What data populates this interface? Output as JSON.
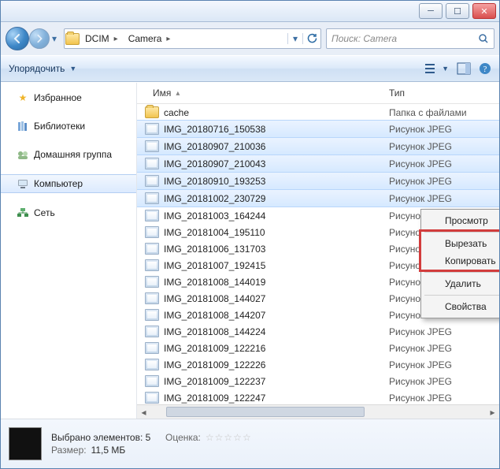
{
  "window": {
    "min": "─",
    "max": "☐",
    "close": "✕"
  },
  "breadcrumbs": [
    "DCIM",
    "Camera"
  ],
  "search": {
    "placeholder": "Поиск: Camera"
  },
  "toolbar": {
    "organize": "Упорядочить"
  },
  "nav": {
    "favorites": "Избранное",
    "libraries": "Библиотеки",
    "homegroup": "Домашняя группа",
    "computer": "Компьютер",
    "network": "Сеть"
  },
  "columns": {
    "name": "Имя",
    "type": "Тип"
  },
  "types": {
    "folder": "Папка с файлами",
    "jpeg": "Рисунок JPEG"
  },
  "files": [
    {
      "name": "cache",
      "kind": "folder",
      "sel": false
    },
    {
      "name": "IMG_20180716_150538",
      "kind": "jpeg",
      "sel": true
    },
    {
      "name": "IMG_20180907_210036",
      "kind": "jpeg",
      "sel": true
    },
    {
      "name": "IMG_20180907_210043",
      "kind": "jpeg",
      "sel": true
    },
    {
      "name": "IMG_20180910_193253",
      "kind": "jpeg",
      "sel": true
    },
    {
      "name": "IMG_20181002_230729",
      "kind": "jpeg",
      "sel": true
    },
    {
      "name": "IMG_20181003_164244",
      "kind": "jpeg",
      "sel": false
    },
    {
      "name": "IMG_20181004_195110",
      "kind": "jpeg",
      "sel": false
    },
    {
      "name": "IMG_20181006_131703",
      "kind": "jpeg",
      "sel": false
    },
    {
      "name": "IMG_20181007_192415",
      "kind": "jpeg",
      "sel": false
    },
    {
      "name": "IMG_20181008_144019",
      "kind": "jpeg",
      "sel": false
    },
    {
      "name": "IMG_20181008_144027",
      "kind": "jpeg",
      "sel": false
    },
    {
      "name": "IMG_20181008_144207",
      "kind": "jpeg",
      "sel": false
    },
    {
      "name": "IMG_20181008_144224",
      "kind": "jpeg",
      "sel": false
    },
    {
      "name": "IMG_20181009_122216",
      "kind": "jpeg",
      "sel": false
    },
    {
      "name": "IMG_20181009_122226",
      "kind": "jpeg",
      "sel": false
    },
    {
      "name": "IMG_20181009_122237",
      "kind": "jpeg",
      "sel": false
    },
    {
      "name": "IMG_20181009_122247",
      "kind": "jpeg",
      "sel": false
    }
  ],
  "ctx": {
    "view": "Просмотр",
    "cut": "Вырезать",
    "copy": "Копировать",
    "delete": "Удалить",
    "props": "Свойства"
  },
  "details": {
    "title": "Выбрано элементов: 5",
    "rating_label": "Оценка:",
    "size_label": "Размер:",
    "size_value": "11,5 МБ"
  }
}
